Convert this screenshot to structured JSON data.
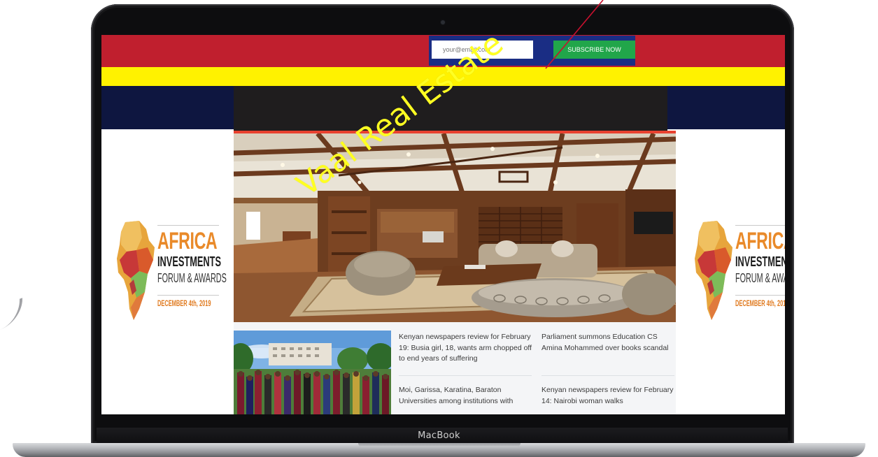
{
  "device": {
    "label": "MacBook"
  },
  "newsletter": {
    "email_placeholder": "your@email.com",
    "subscribe_label": "SUBSCRIBE NOW"
  },
  "watermark": "Vaal Real Estate",
  "ads": {
    "left": {
      "line1": "AFRICA",
      "line2": "INVESTMENTS",
      "line3": "FORUM & AWARDS",
      "date": "DECEMBER 4th, 2019"
    },
    "right": {
      "line1": "AFRICA",
      "line2": "INVESTMENTS",
      "line3": "FORUM & AWARDS",
      "date": "DECEMBER 4th, 2019"
    }
  },
  "news": {
    "items": [
      {
        "title": "Kenyan newspapers review for February 19: Busia girl, 18, wants arm chopped off to end years of suffering"
      },
      {
        "title": "Parliament summons Education CS Amina Mohammed over books scandal"
      },
      {
        "title": "Moi, Garissa, Karatina, Baraton Universities among institutions with"
      },
      {
        "title": "Kenyan newspapers review for February 14: Nairobi woman walks"
      }
    ]
  },
  "colors": {
    "red_bar": "#c01f2e",
    "yellow_bar": "#fff200",
    "navy_bar": "#0e1640",
    "subscribe_green": "#21a64a",
    "accent_red": "#e8412f",
    "watermark_yellow": "#ffff22"
  }
}
